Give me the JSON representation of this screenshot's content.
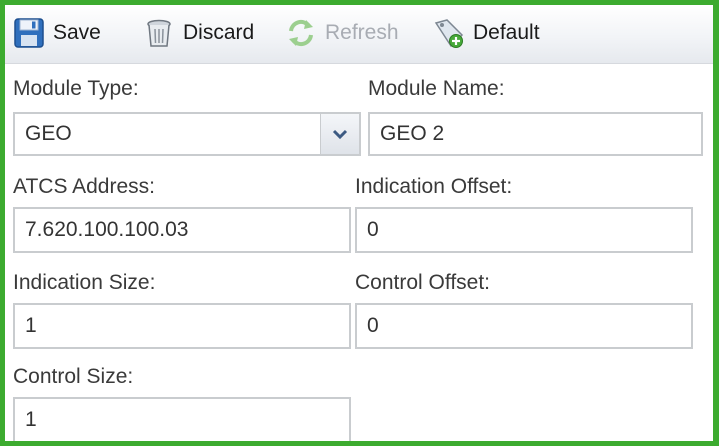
{
  "toolbar": {
    "save_label": "Save",
    "discard_label": "Discard",
    "refresh_label": "Refresh",
    "default_label": "Default"
  },
  "form": {
    "module_type": {
      "label": "Module Type:",
      "value": "GEO"
    },
    "module_name": {
      "label": "Module Name:",
      "value": "GEO 2"
    },
    "atcs_address": {
      "label": "ATCS Address:",
      "value": "7.620.100.100.03"
    },
    "indication_offset": {
      "label": "Indication Offset:",
      "value": "0"
    },
    "indication_size": {
      "label": "Indication Size:",
      "value": "1"
    },
    "control_offset": {
      "label": "Control Offset:",
      "value": "0"
    },
    "control_size": {
      "label": "Control Size:",
      "value": "1"
    }
  },
  "colors": {
    "frame_border": "#3cab2f",
    "field_border": "#c9cccf",
    "disabled_text": "#a8acb3"
  },
  "icons": {
    "save": "floppy-disk-icon",
    "discard": "trash-can-icon",
    "refresh": "refresh-arrows-icon",
    "default": "default-wand-icon",
    "dropdown": "chevron-down-icon"
  }
}
